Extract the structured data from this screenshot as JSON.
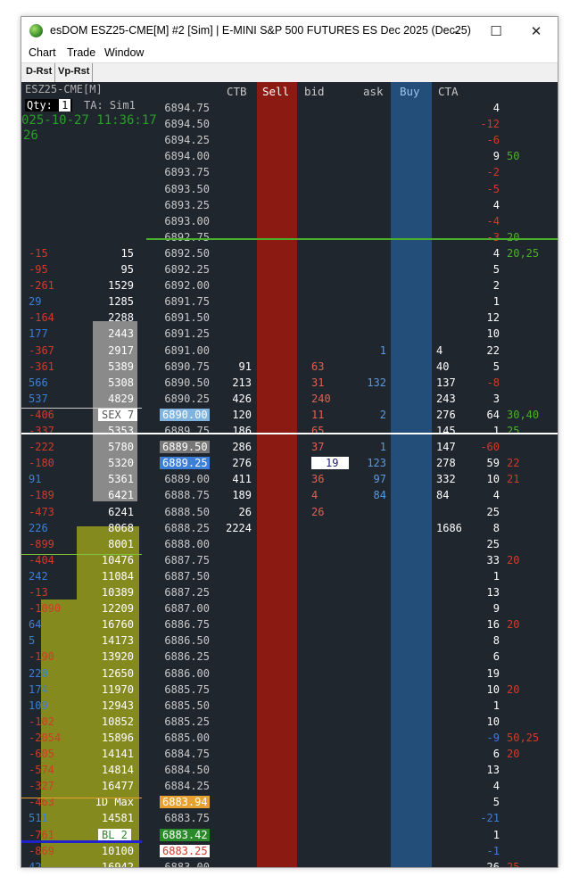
{
  "window": {
    "title": "esDOM ESZ25-CME[M] #2 [Sim]  | E-MINI S&P 500 FUTURES ES Dec 2025 (Dec25)",
    "minimize": "–",
    "maximize": "☐",
    "close": "✕"
  },
  "menu": [
    "Chart",
    "Trade",
    "Window"
  ],
  "toolbar": [
    "D-Rst",
    "Vp-Rst"
  ],
  "dom": {
    "symbol": "ESZ25-CME[M]",
    "qty_label": "Qty:",
    "qty_value": "1",
    "ta": "TA: Sim1",
    "datetime": "025-10-27 11:36:17",
    "sub": "26",
    "headers": {
      "ctb": "CTB",
      "sell": "Sell",
      "bid": "bid",
      "ask": "ask",
      "buy": "Buy",
      "cta": "CTA"
    },
    "tags": {
      "sex": "SEX 7",
      "max": "1D Max",
      "bl": "BL 2"
    },
    "rows": [
      {
        "p": "6894.75",
        "vol": "",
        "cum": "",
        "ctb": "",
        "bid": "",
        "ask": "",
        "cta": "",
        "r": "4",
        "rc": "w",
        "x": ""
      },
      {
        "p": "6894.50",
        "vol": "",
        "cum": "",
        "ctb": "",
        "bid": "",
        "ask": "",
        "cta": "",
        "r": "-12",
        "rc": "r",
        "x": ""
      },
      {
        "p": "6894.25",
        "vol": "",
        "cum": "",
        "ctb": "",
        "bid": "",
        "ask": "",
        "cta": "",
        "r": "-6",
        "rc": "r",
        "x": ""
      },
      {
        "p": "6894.00",
        "vol": "",
        "cum": "",
        "ctb": "",
        "bid": "",
        "ask": "",
        "cta": "",
        "r": "9",
        "rc": "w",
        "x": "50"
      },
      {
        "p": "6893.75",
        "vol": "",
        "cum": "",
        "ctb": "",
        "bid": "",
        "ask": "",
        "cta": "",
        "r": "-2",
        "rc": "r",
        "x": ""
      },
      {
        "p": "6893.50",
        "vol": "",
        "cum": "",
        "ctb": "",
        "bid": "",
        "ask": "",
        "cta": "",
        "r": "-5",
        "rc": "r",
        "x": ""
      },
      {
        "p": "6893.25",
        "vol": "",
        "cum": "",
        "ctb": "",
        "bid": "",
        "ask": "",
        "cta": "",
        "r": "4",
        "rc": "w",
        "x": ""
      },
      {
        "p": "6893.00",
        "vol": "",
        "cum": "",
        "ctb": "",
        "bid": "",
        "ask": "",
        "cta": "",
        "r": "-4",
        "rc": "r",
        "x": ""
      },
      {
        "p": "6892.75",
        "vol": "",
        "cum": "",
        "ctb": "",
        "bid": "",
        "ask": "",
        "cta": "",
        "r": "-3",
        "rc": "r",
        "x": "20"
      },
      {
        "p": "6892.50",
        "vol": "-15",
        "cum": "15",
        "ctb": "",
        "bid": "",
        "ask": "",
        "cta": "",
        "r": "4",
        "rc": "w",
        "x": "20,25"
      },
      {
        "p": "6892.25",
        "vol": "-95",
        "cum": "95",
        "ctb": "",
        "bid": "",
        "ask": "",
        "cta": "",
        "r": "5",
        "rc": "w",
        "x": ""
      },
      {
        "p": "6892.00",
        "vol": "-261",
        "cum": "1529",
        "ctb": "",
        "bid": "",
        "ask": "",
        "cta": "",
        "r": "2",
        "rc": "w",
        "x": ""
      },
      {
        "p": "6891.75",
        "vol": "29",
        "cum": "1285",
        "ctb": "",
        "bid": "",
        "ask": "",
        "cta": "",
        "r": "1",
        "rc": "w",
        "x": ""
      },
      {
        "p": "6891.50",
        "vol": "-164",
        "cum": "2288",
        "ctb": "",
        "bid": "",
        "ask": "",
        "cta": "",
        "r": "12",
        "rc": "w",
        "x": ""
      },
      {
        "p": "6891.25",
        "vol": "177",
        "cum": "2443",
        "ctb": "",
        "bid": "",
        "ask": "",
        "cta": "",
        "r": "10",
        "rc": "w",
        "x": ""
      },
      {
        "p": "6891.00",
        "vol": "-367",
        "cum": "2917",
        "ctb": "",
        "bid": "",
        "ask": "1",
        "cta": "4",
        "r": "22",
        "rc": "w",
        "x": ""
      },
      {
        "p": "6890.75",
        "vol": "-361",
        "cum": "5389",
        "ctb": "91",
        "bid": "63",
        "ask": "",
        "cta": "40",
        "r": "5",
        "rc": "w",
        "x": ""
      },
      {
        "p": "6890.50",
        "vol": "566",
        "cum": "5308",
        "ctb": "213",
        "bid": "31",
        "ask": "132",
        "cta": "137",
        "r": "-8",
        "rc": "r",
        "x": ""
      },
      {
        "p": "6890.25",
        "vol": "537",
        "cum": "4829",
        "ctb": "426",
        "bid": "240",
        "ask": "",
        "cta": "243",
        "r": "3",
        "rc": "w",
        "x": ""
      },
      {
        "p": "6890.00",
        "vol": "-406",
        "cum": "SEX 7",
        "ctb": "120",
        "bid": "11",
        "ask": "2",
        "cta": "276",
        "r": "64",
        "rc": "w",
        "x": "30,40"
      },
      {
        "p": "6889.75",
        "vol": "-337",
        "cum": "5353",
        "ctb": "186",
        "bid": "65",
        "ask": "",
        "cta": "145",
        "r": "1",
        "rc": "w",
        "x": "25"
      },
      {
        "p": "6889.50",
        "vol": "-222",
        "cum": "5780",
        "ctb": "286",
        "bid": "37",
        "ask": "1",
        "cta": "147",
        "r": "-60",
        "rc": "r",
        "x": ""
      },
      {
        "p": "6889.25",
        "vol": "-180",
        "cum": "5320",
        "ctb": "276",
        "bid": "19",
        "ask": "123",
        "cta": "278",
        "r": "59",
        "rc": "w",
        "x": "22"
      },
      {
        "p": "6889.00",
        "vol": "91",
        "cum": "5361",
        "ctb": "411",
        "bid": "36",
        "ask": "97",
        "cta": "332",
        "r": "10",
        "rc": "w",
        "x": "21"
      },
      {
        "p": "6888.75",
        "vol": "-189",
        "cum": "6421",
        "ctb": "189",
        "bid": "4",
        "ask": "84",
        "cta": "84",
        "r": "4",
        "rc": "w",
        "x": ""
      },
      {
        "p": "6888.50",
        "vol": "-473",
        "cum": "6241",
        "ctb": "26",
        "bid": "26",
        "ask": "",
        "cta": "",
        "r": "25",
        "rc": "w",
        "x": ""
      },
      {
        "p": "6888.25",
        "vol": "226",
        "cum": "8068",
        "ctb": "2224",
        "bid": "",
        "ask": "",
        "cta": "1686",
        "r": "8",
        "rc": "w",
        "x": ""
      },
      {
        "p": "6888.00",
        "vol": "-899",
        "cum": "8001",
        "ctb": "",
        "bid": "",
        "ask": "",
        "cta": "",
        "r": "25",
        "rc": "w",
        "x": ""
      },
      {
        "p": "6887.75",
        "vol": "-404",
        "cum": "10476",
        "ctb": "",
        "bid": "",
        "ask": "",
        "cta": "",
        "r": "33",
        "rc": "w",
        "x": "20"
      },
      {
        "p": "6887.50",
        "vol": "242",
        "cum": "11084",
        "ctb": "",
        "bid": "",
        "ask": "",
        "cta": "",
        "r": "1",
        "rc": "w",
        "x": ""
      },
      {
        "p": "6887.25",
        "vol": "-13",
        "cum": "10389",
        "ctb": "",
        "bid": "",
        "ask": "",
        "cta": "",
        "r": "13",
        "rc": "w",
        "x": ""
      },
      {
        "p": "6887.00",
        "vol": "-1090",
        "cum": "12209",
        "ctb": "",
        "bid": "",
        "ask": "",
        "cta": "",
        "r": "9",
        "rc": "w",
        "x": ""
      },
      {
        "p": "6886.75",
        "vol": "64",
        "cum": "16760",
        "ctb": "",
        "bid": "",
        "ask": "",
        "cta": "",
        "r": "16",
        "rc": "w",
        "x": "20"
      },
      {
        "p": "6886.50",
        "vol": "5",
        "cum": "14173",
        "ctb": "",
        "bid": "",
        "ask": "",
        "cta": "",
        "r": "8",
        "rc": "w",
        "x": ""
      },
      {
        "p": "6886.25",
        "vol": "-190",
        "cum": "13920",
        "ctb": "",
        "bid": "",
        "ask": "",
        "cta": "",
        "r": "6",
        "rc": "w",
        "x": ""
      },
      {
        "p": "6886.00",
        "vol": "220",
        "cum": "12650",
        "ctb": "",
        "bid": "",
        "ask": "",
        "cta": "",
        "r": "19",
        "rc": "w",
        "x": ""
      },
      {
        "p": "6885.75",
        "vol": "174",
        "cum": "11970",
        "ctb": "",
        "bid": "",
        "ask": "",
        "cta": "",
        "r": "10",
        "rc": "w",
        "x": "20"
      },
      {
        "p": "6885.50",
        "vol": "109",
        "cum": "12943",
        "ctb": "",
        "bid": "",
        "ask": "",
        "cta": "",
        "r": "1",
        "rc": "w",
        "x": ""
      },
      {
        "p": "6885.25",
        "vol": "-102",
        "cum": "10852",
        "ctb": "",
        "bid": "",
        "ask": "",
        "cta": "",
        "r": "10",
        "rc": "w",
        "x": ""
      },
      {
        "p": "6885.00",
        "vol": "-2054",
        "cum": "15896",
        "ctb": "",
        "bid": "",
        "ask": "",
        "cta": "",
        "r": "-9",
        "rc": "b",
        "x": "50,25"
      },
      {
        "p": "6884.75",
        "vol": "-605",
        "cum": "14141",
        "ctb": "",
        "bid": "",
        "ask": "",
        "cta": "",
        "r": "6",
        "rc": "w",
        "x": "20"
      },
      {
        "p": "6884.50",
        "vol": "-574",
        "cum": "14814",
        "ctb": "",
        "bid": "",
        "ask": "",
        "cta": "",
        "r": "13",
        "rc": "w",
        "x": ""
      },
      {
        "p": "6884.25",
        "vol": "-327",
        "cum": "16477",
        "ctb": "",
        "bid": "",
        "ask": "",
        "cta": "",
        "r": "4",
        "rc": "w",
        "x": ""
      },
      {
        "p": "6883.94",
        "vol": "-463",
        "cum": "1D Max",
        "ctb": "",
        "bid": "",
        "ask": "",
        "cta": "",
        "r": "5",
        "rc": "w",
        "x": ""
      },
      {
        "p": "6883.75",
        "vol": "511",
        "cum": "14581",
        "ctb": "",
        "bid": "",
        "ask": "",
        "cta": "",
        "r": "-21",
        "rc": "b",
        "x": ""
      },
      {
        "p": "6883.42",
        "vol": "-761",
        "cum": "BL 2",
        "ctb": "",
        "bid": "",
        "ask": "",
        "cta": "",
        "r": "1",
        "rc": "w",
        "x": ""
      },
      {
        "p": "6883.25",
        "vol": "-869",
        "cum": "10100",
        "ctb": "",
        "bid": "",
        "ask": "",
        "cta": "",
        "r": "-1",
        "rc": "b",
        "x": ""
      },
      {
        "p": "6883.00",
        "vol": "42",
        "cum": "16942",
        "ctb": "",
        "bid": "",
        "ask": "",
        "cta": "",
        "r": "26",
        "rc": "w",
        "x": "25"
      }
    ]
  }
}
